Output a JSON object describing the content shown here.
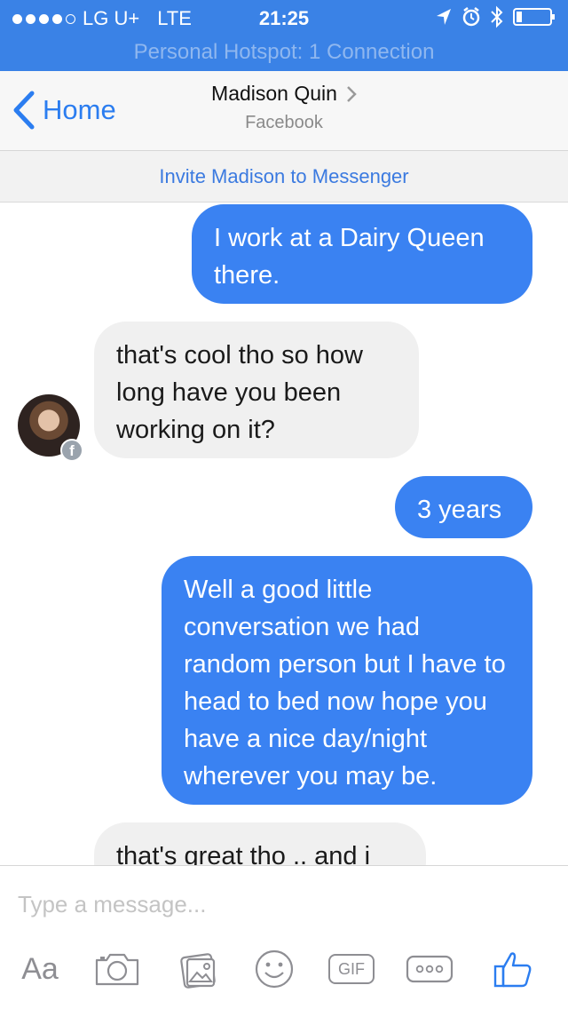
{
  "status_bar": {
    "carrier": "LG U+",
    "network": "LTE",
    "time": "21:25",
    "signal_bars_filled": 4,
    "signal_bars_total": 5
  },
  "hotspot_text": "Personal Hotspot: 1 Connection",
  "nav": {
    "back_label": "Home",
    "contact_name": "Madison Quin",
    "subtitle": "Facebook"
  },
  "invite_text": "Invite Madison to Messenger",
  "messages": [
    {
      "direction": "out",
      "text": "I work at a Dairy Queen there."
    },
    {
      "direction": "in",
      "text": "that's cool tho so how long have you been working on it?"
    },
    {
      "direction": "out",
      "text": "3 years"
    },
    {
      "direction": "out",
      "text": "Well a good little conversation we had random person but I have to head to bed now hope you have a nice day/night wherever you may be."
    },
    {
      "direction": "in",
      "text": "that's great tho .. and i"
    }
  ],
  "composer": {
    "placeholder": "Type a message...",
    "aa_label": "Aa",
    "gif_label": "GIF"
  },
  "colors": {
    "brand_blue": "#3a82e6",
    "outgoing_bubble": "#3a82f2",
    "incoming_bubble": "#f0f0f0",
    "link_blue": "#2b7df0",
    "icon_gray": "#8e8e93"
  },
  "icons": [
    "location-arrow-icon",
    "alarm-icon",
    "bluetooth-icon",
    "battery-icon",
    "back-chevron-icon",
    "chevron-right-icon",
    "facebook-badge-icon",
    "camera-icon",
    "photo-gallery-icon",
    "emoji-icon",
    "gif-icon",
    "more-icon",
    "thumbs-up-icon"
  ]
}
